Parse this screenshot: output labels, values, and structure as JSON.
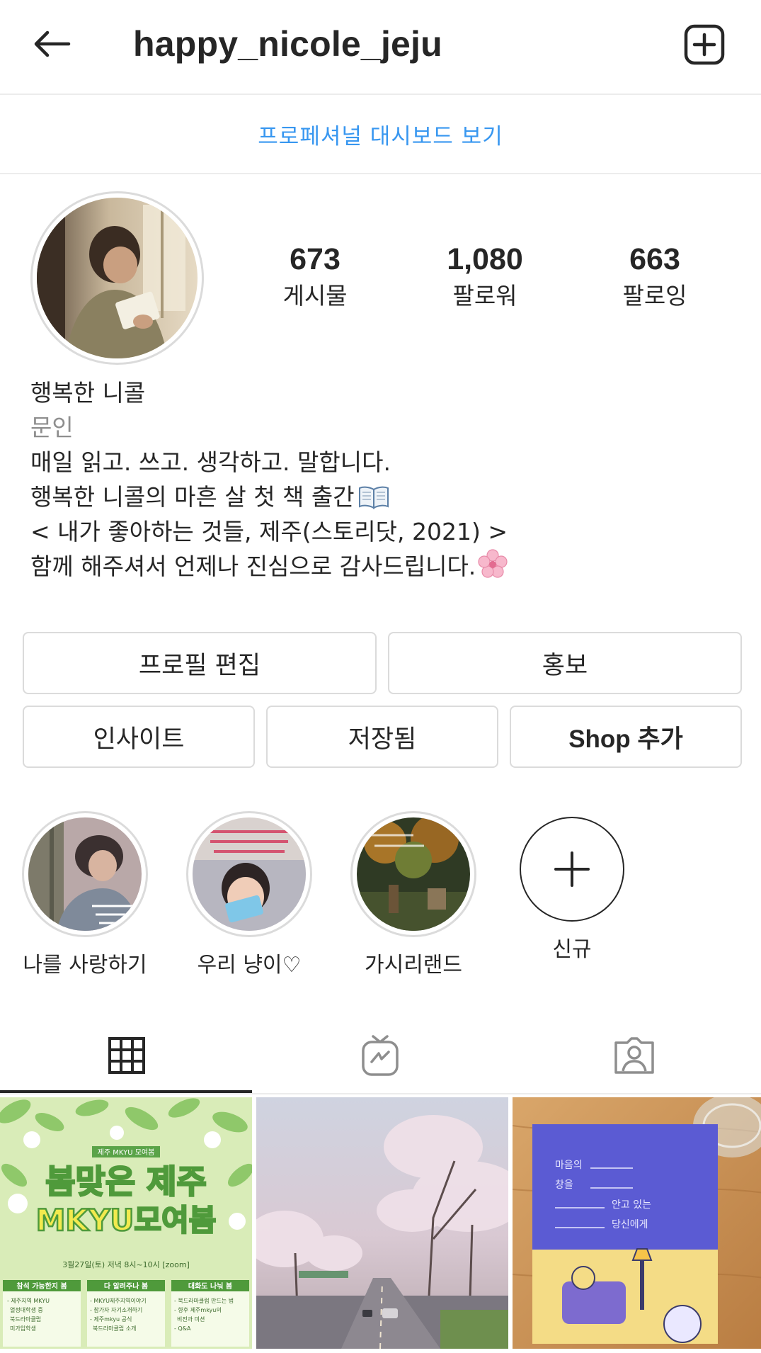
{
  "header": {
    "username": "happy_nicole_jeju",
    "back_icon": "arrow-left-icon",
    "new_post_icon": "plus-square-icon"
  },
  "dashboard_link": "프로페셔널 대시보드 보기",
  "profile": {
    "stats": [
      {
        "value": "673",
        "label": "게시물"
      },
      {
        "value": "1,080",
        "label": "팔로워"
      },
      {
        "value": "663",
        "label": "팔로잉"
      }
    ],
    "display_name": "행복한 니콜",
    "category": "문인",
    "bio": [
      "매일 읽고. 쓰고. 생각하고. 말합니다.",
      "행복한 니콜의 마흔 살 첫 책 출간",
      "< 내가 좋아하는 것들, 제주(스토리닷, 2021) >",
      "함께 해주셔서 언제나 진심으로 감사드립니다."
    ]
  },
  "buttons": {
    "edit_profile": "프로필 편집",
    "promote": "홍보",
    "insights": "인사이트",
    "saved": "저장됨",
    "add_shop": "Shop 추가"
  },
  "highlights": [
    {
      "label": "나를 사랑하기"
    },
    {
      "label": "우리 냥이♡"
    },
    {
      "label": "가시리랜드"
    },
    {
      "label": "신규"
    }
  ],
  "tabs": [
    {
      "icon": "grid-icon",
      "active": true
    },
    {
      "icon": "igtv-icon",
      "active": false
    },
    {
      "icon": "tagged-icon",
      "active": false
    }
  ],
  "posts": {
    "post1": {
      "badge": "제주 MKYU 모여봄",
      "title_line1": "봄맞은 제주",
      "title_line2": "MKYU모여봄",
      "date": "3월27일(토) 저녁 8시~10시 [zoom]",
      "col1_title": "참석 가능한지 봄",
      "col1_items": [
        "- 제주지역 MKYU",
        "열정대학생 중",
        "북드라마클럽",
        "미가입학생"
      ],
      "col2_title": "다 알려주나 봄",
      "col2_items": [
        "- MKYU제주지역이야기",
        "- 참가자 자기소개하기",
        "- 제주mkyu 공식",
        "북드라마클럽 소개"
      ],
      "col3_title": "대화도 나눠 봄",
      "col3_items": [
        "- 북드라마클럽 만드는 법",
        "- 향후 제주mkyu의",
        "비전과 미션",
        "- Q&A"
      ]
    },
    "post3": {
      "book_title": [
        "마음의",
        "창을",
        "안고 있는",
        "당신에게"
      ]
    }
  },
  "colors": {
    "text": "#262626",
    "secondary": "#8e8e8e",
    "link": "#3897f0",
    "border": "#dbdbdb"
  }
}
